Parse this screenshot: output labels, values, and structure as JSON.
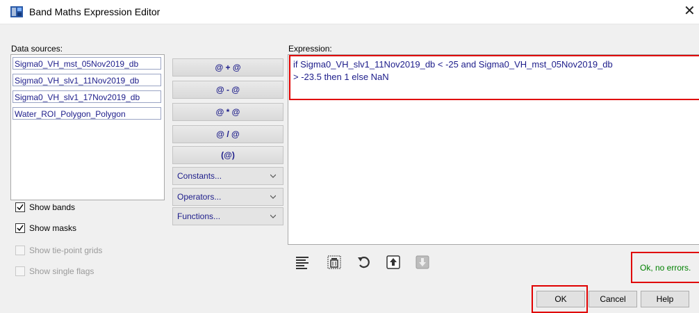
{
  "window": {
    "title": "Band Maths Expression Editor",
    "close_glyph": "✕"
  },
  "data_sources": {
    "label": "Data sources:",
    "items": [
      "Sigma0_VH_mst_05Nov2019_db",
      "Sigma0_VH_slv1_11Nov2019_db",
      "Sigma0_VH_slv1_17Nov2019_db",
      "Water_ROI_Polygon_Polygon"
    ]
  },
  "operators": [
    "@ + @",
    "@ - @",
    "@ * @",
    "@ / @",
    "(@)"
  ],
  "dropdowns": [
    "Constants...",
    "Operators...",
    "Functions..."
  ],
  "checkboxes": [
    {
      "label": "Show bands",
      "checked": true,
      "enabled": true
    },
    {
      "label": "Show masks",
      "checked": true,
      "enabled": true
    },
    {
      "label": "Show tie-point grids",
      "checked": false,
      "enabled": false
    },
    {
      "label": "Show single flags",
      "checked": false,
      "enabled": false
    }
  ],
  "expression": {
    "label": "Expression:",
    "value": "if Sigma0_VH_slv1_11Nov2019_db < -25 and Sigma0_VH_mst_05Nov2019_db\n> -23.5 then 1 else NaN"
  },
  "toolbar_icons": [
    "format-icon",
    "delete-icon",
    "undo-icon",
    "load-icon",
    "save-icon"
  ],
  "status": {
    "text": "Ok, no errors.",
    "color": "#008000"
  },
  "buttons": {
    "ok": "OK",
    "cancel": "Cancel",
    "help": "Help"
  },
  "colors": {
    "highlight": "#e00000",
    "text_blue": "#1c1c8a"
  }
}
